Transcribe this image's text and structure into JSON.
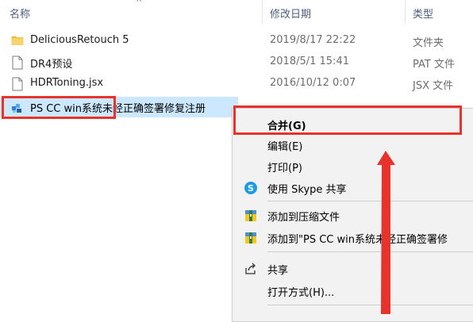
{
  "columns": {
    "name": "名称",
    "date": "修改日期",
    "type": "类型"
  },
  "files": [
    {
      "name": "DeliciousRetouch 5",
      "date": "2019/8/17 22:22",
      "type": "文件夹",
      "icon": "folder-icon"
    },
    {
      "name": "DR4预设",
      "date": "2018/5/1 15:41",
      "type": "PAT 文件",
      "icon": "file-icon"
    },
    {
      "name": "HDRToning.jsx",
      "date": "2016/10/12 0:07",
      "type": "JSX 文件",
      "icon": "file-icon"
    },
    {
      "name": "PS CC  win系统未经正确签署修复注册",
      "date": "",
      "type": "",
      "icon": "registry-file-icon"
    }
  ],
  "context_menu": {
    "merge": "合并(G)",
    "edit": "编辑(E)",
    "print": "打印(P)",
    "skype_share": "使用 Skype 共享",
    "add_archive": "添加到压缩文件",
    "add_named_archive": "添加到\"PS CC  win系统未经正确签署修",
    "share": "共享",
    "open_with": "打开方式(H)..."
  },
  "colors": {
    "highlight": "#e8332c",
    "selection": "#cce8ff",
    "folder": "#f3c444"
  }
}
